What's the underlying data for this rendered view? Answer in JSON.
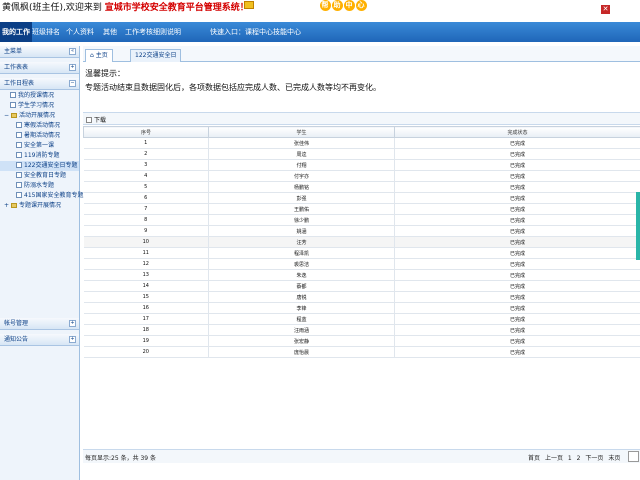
{
  "header": {
    "welcome_prefix": "黄佩枫(班主任),欢迎来到",
    "school_title": "宣城市学校安全教育平台管理系统！",
    "help_chars": [
      "帮",
      "助",
      "中",
      "心"
    ]
  },
  "nav": {
    "items": [
      "我的工作",
      "班级排名",
      "个人资料",
      "其他",
      "工作考核细则说明",
      "快速入口：课程中心",
      "技能中心"
    ]
  },
  "sidebar": {
    "title": "主菜单",
    "sections": [
      {
        "label": "工作表表"
      },
      {
        "label": "工作日程表"
      }
    ],
    "tree": [
      {
        "label": "我的授课情况",
        "type": "doc"
      },
      {
        "label": "学生学习情况",
        "type": "doc"
      },
      {
        "label": "活动开展情况",
        "type": "folder"
      },
      {
        "label": "寒假活动情况",
        "type": "doc"
      },
      {
        "label": "暑期活动情况",
        "type": "doc"
      },
      {
        "label": "安全第一课",
        "type": "doc"
      },
      {
        "label": "119消防专题",
        "type": "doc"
      },
      {
        "label": "122交通安全日专题",
        "type": "doc",
        "selected": true
      },
      {
        "label": "安全教育日专题",
        "type": "doc"
      },
      {
        "label": "防溺水专题",
        "type": "doc"
      },
      {
        "label": "415国家安全教育专题",
        "type": "doc"
      },
      {
        "label": "专题课开展情况",
        "type": "folder"
      }
    ],
    "bottom_sections": [
      {
        "label": "帐号管理"
      },
      {
        "label": "通知公告"
      }
    ]
  },
  "tabs": [
    "主页",
    "122交通安全日"
  ],
  "tip": {
    "title": "温馨提示：",
    "text": "专题活动结束且数据固化后，各项数据包括应完成人数、已完成人数等均不再变化。"
  },
  "toolbar": {
    "download": "下载"
  },
  "table": {
    "headers": [
      "序号",
      "学生",
      "完成状态"
    ],
    "rows": [
      [
        "1",
        "张佳伟",
        "已完成"
      ],
      [
        "2",
        "周逵",
        "已完成"
      ],
      [
        "3",
        "付翔",
        "已完成"
      ],
      [
        "4",
        "付宇亦",
        "已完成"
      ],
      [
        "5",
        "杨鹏铭",
        "已完成"
      ],
      [
        "6",
        "彭强",
        "已完成"
      ],
      [
        "7",
        "王鹏佑",
        "已完成"
      ],
      [
        "8",
        "徐少鹏",
        "已完成"
      ],
      [
        "9",
        "姚涵",
        "已完成"
      ],
      [
        "10",
        "汪芳",
        "已完成"
      ],
      [
        "11",
        "程泽凯",
        "已完成"
      ],
      [
        "12",
        "裘思洁",
        "已完成"
      ],
      [
        "13",
        "朱逸",
        "已完成"
      ],
      [
        "14",
        "蔡都",
        "已完成"
      ],
      [
        "15",
        "唐锐",
        "已完成"
      ],
      [
        "16",
        "李锋",
        "已完成"
      ],
      [
        "17",
        "程蓝",
        "已完成"
      ],
      [
        "18",
        "汪雨涵",
        "已完成"
      ],
      [
        "19",
        "张宏静",
        "已完成"
      ],
      [
        "20",
        "庞怡晨",
        "已完成"
      ]
    ]
  },
  "pager": {
    "summary": "每页显示:25 条，共 39 条",
    "first": "首页",
    "prev": "上一页",
    "page1": "1",
    "page2": "2",
    "next": "下一页",
    "last": "末页"
  }
}
